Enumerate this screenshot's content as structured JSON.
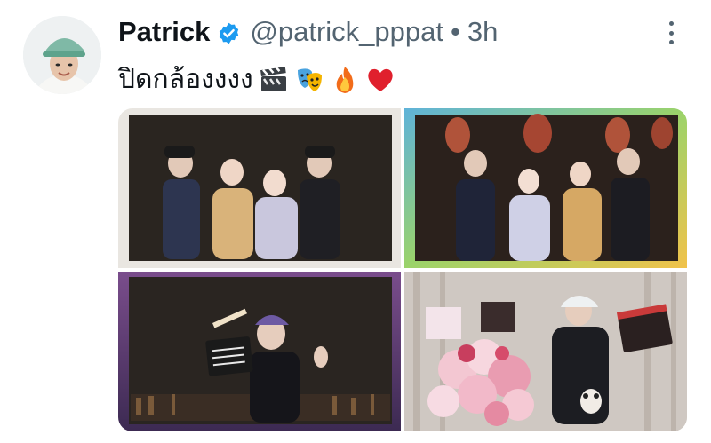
{
  "user": {
    "name": "Patrick",
    "handle": "@patrick_pppat",
    "separator": "•",
    "time": "3h"
  },
  "tweet": {
    "text": "ปิดกล้องงงง",
    "emojis": [
      "clapperboard-emoji",
      "performing-arts-emoji",
      "fire-emoji",
      "red-heart-emoji"
    ]
  },
  "media": {
    "photos": [
      "group-photo-costumes",
      "group-photo-lanterns",
      "clapperboard-photo",
      "flowers-photo"
    ]
  },
  "colors": {
    "verified": "#1d9bf0",
    "secondary_text": "#536471"
  }
}
